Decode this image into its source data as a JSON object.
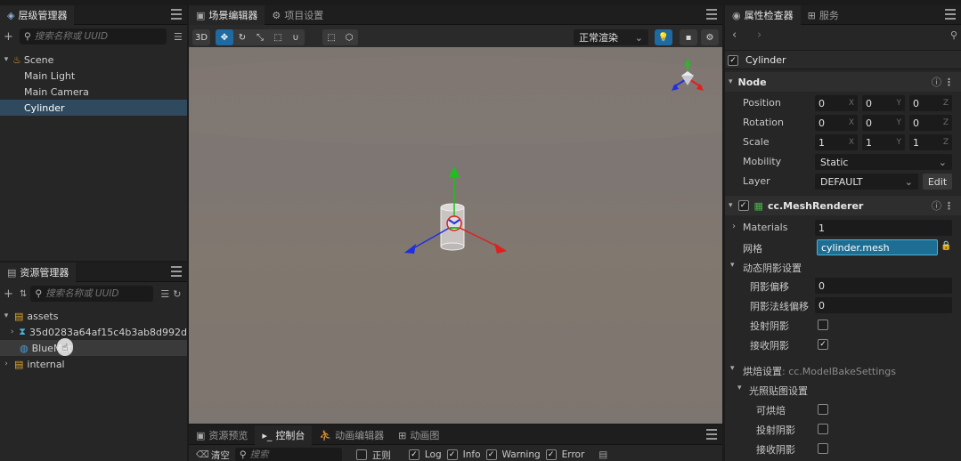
{
  "hierarchy": {
    "tab_label": "层级管理器",
    "search_placeholder": "搜索名称或 UUID",
    "items": [
      {
        "label": "Scene"
      },
      {
        "label": "Main Light"
      },
      {
        "label": "Main Camera"
      },
      {
        "label": "Cylinder"
      }
    ]
  },
  "assets": {
    "tab_label": "资源管理器",
    "search_placeholder": "搜索名称或 UUID",
    "items": [
      {
        "label": "assets"
      },
      {
        "label": "35d0283a64af15c4b3ab8d992d"
      },
      {
        "label": "BlueMat"
      },
      {
        "label": "internal"
      }
    ]
  },
  "scene": {
    "tabs": [
      {
        "label": "场景编辑器"
      },
      {
        "label": "项目设置"
      }
    ],
    "mode_3d": "3D",
    "render_mode": "正常渲染"
  },
  "bottom": {
    "tabs": [
      {
        "label": "资源预览"
      },
      {
        "label": "控制台"
      },
      {
        "label": "动画编辑器"
      },
      {
        "label": "动画图"
      }
    ],
    "clear_label": "清空",
    "search_placeholder": "搜索",
    "filters": [
      {
        "label": "正则",
        "checked": false
      },
      {
        "label": "Log",
        "checked": true
      },
      {
        "label": "Info",
        "checked": true
      },
      {
        "label": "Warning",
        "checked": true
      },
      {
        "label": "Error",
        "checked": true
      }
    ]
  },
  "inspector": {
    "tabs": [
      {
        "label": "属性检查器"
      },
      {
        "label": "服务"
      }
    ],
    "node_name": "Cylinder",
    "node_section": "Node",
    "position_label": "Position",
    "rotation_label": "Rotation",
    "scale_label": "Scale",
    "mobility_label": "Mobility",
    "layer_label": "Layer",
    "position": [
      "0",
      "0",
      "0"
    ],
    "rotation": [
      "0",
      "0",
      "0"
    ],
    "scale": [
      "1",
      "1",
      "1"
    ],
    "axes": [
      "X",
      "Y",
      "Z"
    ],
    "mobility": "Static",
    "layer": "DEFAULT",
    "edit_label": "Edit",
    "mesh_renderer": {
      "title": "cc.MeshRenderer",
      "materials_label": "Materials",
      "materials_count": "1",
      "mesh_label": "网格",
      "mesh_value": "cylinder.mesh",
      "shadow_section": "动态阴影设置",
      "shadow_bias_label": "阴影偏移",
      "shadow_bias": "0",
      "shadow_normal_bias_label": "阴影法线偏移",
      "shadow_normal_bias": "0",
      "cast_shadow_label": "投射阴影",
      "cast_shadow": false,
      "receive_shadow_label": "接收阴影",
      "receive_shadow": true,
      "bake_section": "烘焙设置",
      "bake_type": ": cc.ModelBakeSettings",
      "lightmap_section": "光照贴图设置",
      "bakeable_label": "可烘焙",
      "bake_cast_label": "投射阴影",
      "bake_receive_label": "接收阴影"
    }
  },
  "colors": {
    "accent": "#1e6aa1",
    "selection": "#2f4a5e",
    "gizmo_x": "#e01f1f",
    "gizmo_y": "#1fbf1f",
    "gizmo_z": "#1f2fe0"
  }
}
